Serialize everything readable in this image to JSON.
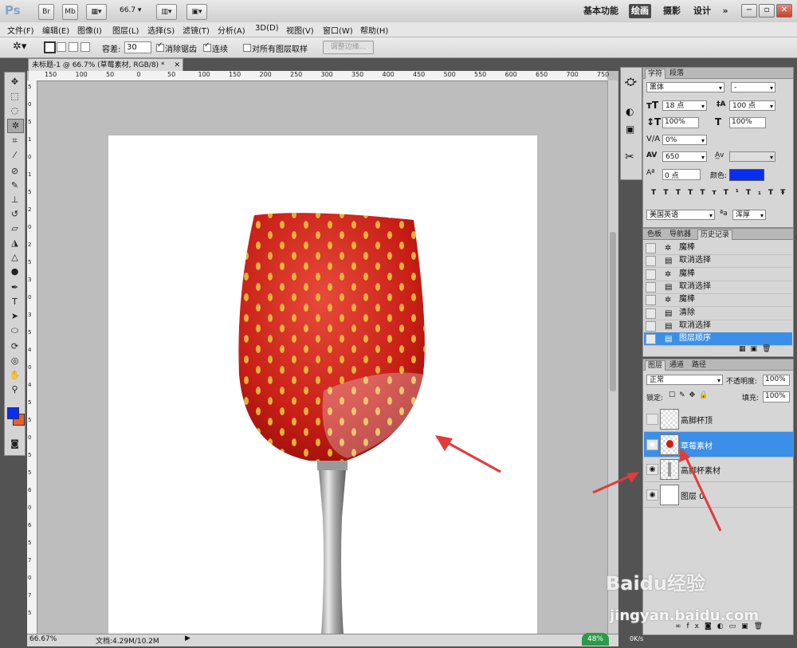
{
  "app": {
    "logo": "Ps",
    "bridge_btn": "Br",
    "mini_btn": "Mb",
    "zoom": "66.7",
    "workspaces": [
      "基本功能",
      "绘画",
      "摄影",
      "设计"
    ],
    "active_workspace": "绘画",
    "more": "»"
  },
  "menu": [
    "文件(F)",
    "编辑(E)",
    "图像(I)",
    "图层(L)",
    "选择(S)",
    "滤镜(T)",
    "分析(A)",
    "3D(D)",
    "视图(V)",
    "窗口(W)",
    "帮助(H)"
  ],
  "options": {
    "tolerance_label": "容差:",
    "tolerance_value": "30",
    "antialias_label": "消除锯齿",
    "contiguous_label": "连续",
    "sample_all_label": "对所有图层取样",
    "refine_edge_btn": "调整边缘..."
  },
  "document": {
    "tab_title": "未标题-1 @ 66.7% (草莓素材, RGB/8) *",
    "ruler_h": [
      "150",
      "100",
      "50",
      "0",
      "50",
      "100",
      "150",
      "200",
      "250",
      "300",
      "350",
      "400",
      "450",
      "500",
      "550",
      "600",
      "650",
      "700",
      "750"
    ],
    "ruler_v": [
      "5",
      "0",
      "5",
      "1",
      "0",
      "1",
      "5",
      "2",
      "0",
      "2",
      "5",
      "3",
      "0",
      "3",
      "5",
      "4",
      "0",
      "4",
      "5",
      "5",
      "0",
      "5",
      "5",
      "6",
      "0",
      "6",
      "5",
      "7",
      "0",
      "7",
      "5"
    ],
    "zoom_status": "66.67%",
    "doc_size": "文档:4.29M/10.2M",
    "network_pct": "48%",
    "network_speed": "0K/s"
  },
  "character_panel": {
    "tabs": [
      "字符",
      "段落"
    ],
    "font_family": "黑体",
    "font_style": "-",
    "font_size": "18 点",
    "leading": "100 点",
    "vscale": "100%",
    "hscale": "100%",
    "baseline_shift_pct": "0%",
    "tracking": "650",
    "baseline": "0 点",
    "color_label": "颜色:",
    "color": "#0a2ef0",
    "style_buttons": [
      "T",
      "T",
      "TT",
      "Tт",
      "T¹",
      "T₁",
      "T",
      "Ŧ"
    ],
    "language": "美国英语",
    "aa_label": "ªa",
    "aa_value": "浑厚"
  },
  "history_panel": {
    "tabs": [
      "色板",
      "导航器",
      "历史记录"
    ],
    "items": [
      {
        "icon": "magic-wand",
        "label": "魔棒"
      },
      {
        "icon": "document",
        "label": "取消选择"
      },
      {
        "icon": "magic-wand",
        "label": "魔棒"
      },
      {
        "icon": "document",
        "label": "取消选择"
      },
      {
        "icon": "magic-wand",
        "label": "魔棒"
      },
      {
        "icon": "document",
        "label": "清除"
      },
      {
        "icon": "document",
        "label": "取消选择"
      },
      {
        "icon": "document",
        "label": "图层顺序"
      }
    ],
    "selected_index": 7
  },
  "layers_panel": {
    "tabs": [
      "图层",
      "通道",
      "路径"
    ],
    "blend_mode": "正常",
    "opacity_label": "不透明度:",
    "opacity": "100%",
    "lock_label": "锁定:",
    "fill_label": "填充:",
    "fill": "100%",
    "layers": [
      {
        "name": "高脚杯顶",
        "visible": false,
        "thumb": "transparent"
      },
      {
        "name": "草莓素材",
        "visible": true,
        "thumb": "strawberry",
        "selected": true
      },
      {
        "name": "高脚杯素材",
        "visible": true,
        "thumb": "glass"
      },
      {
        "name": "图层 0",
        "visible": true,
        "thumb": "white"
      }
    ]
  },
  "watermark": {
    "brand": "Baidu经验",
    "url": "jingyan.baidu.com"
  },
  "colors": {
    "foreground": "#0a2ef0",
    "background": "#e8612c",
    "selection": "#3b8fe8",
    "annotation_arrow": "#e23b3b"
  }
}
